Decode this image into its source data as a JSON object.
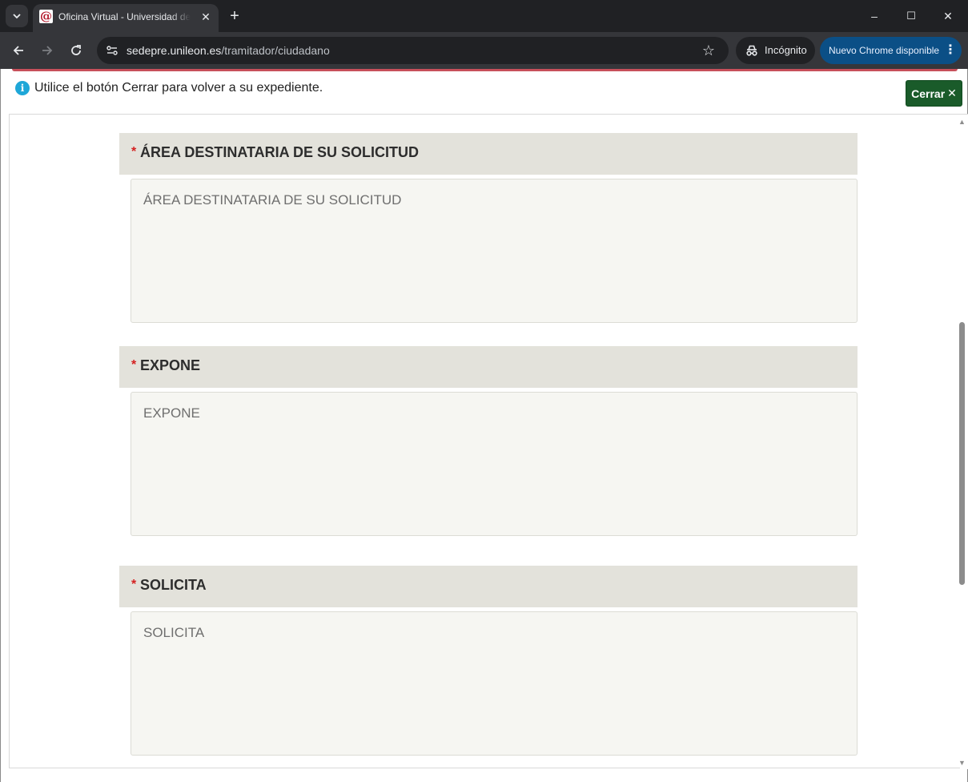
{
  "browser": {
    "tab_title": "Oficina Virtual - Universidad de León",
    "favicon_glyph": "@",
    "new_tab": "+",
    "url_host": "sedepre.unileon.es",
    "url_path": "/tramitador/ciudadano",
    "incognito_label": "Incógnito",
    "update_label": "Nuevo Chrome disponible",
    "window_controls": {
      "minimize": "–",
      "maximize": "☐",
      "close": "✕"
    }
  },
  "notice": {
    "text": "Utilice el botón Cerrar para volver a su expediente.",
    "close_label": "Cerrar",
    "close_symbol": "✕"
  },
  "sections": [
    {
      "required_mark": "*",
      "label": "ÁREA DESTINATARIA DE SU SOLICITUD",
      "placeholder": "ÁREA DESTINATARIA DE SU SOLICITUD"
    },
    {
      "required_mark": "*",
      "label": "EXPONE",
      "placeholder": "EXPONE"
    },
    {
      "required_mark": "*",
      "label": "SOLICITA",
      "placeholder": "SOLICITA"
    }
  ],
  "colors": {
    "accent_green": "#1a5b2a",
    "required_red": "#d42020",
    "section_header_bg": "#e3e2db",
    "update_button_bg": "#0b4f86"
  }
}
